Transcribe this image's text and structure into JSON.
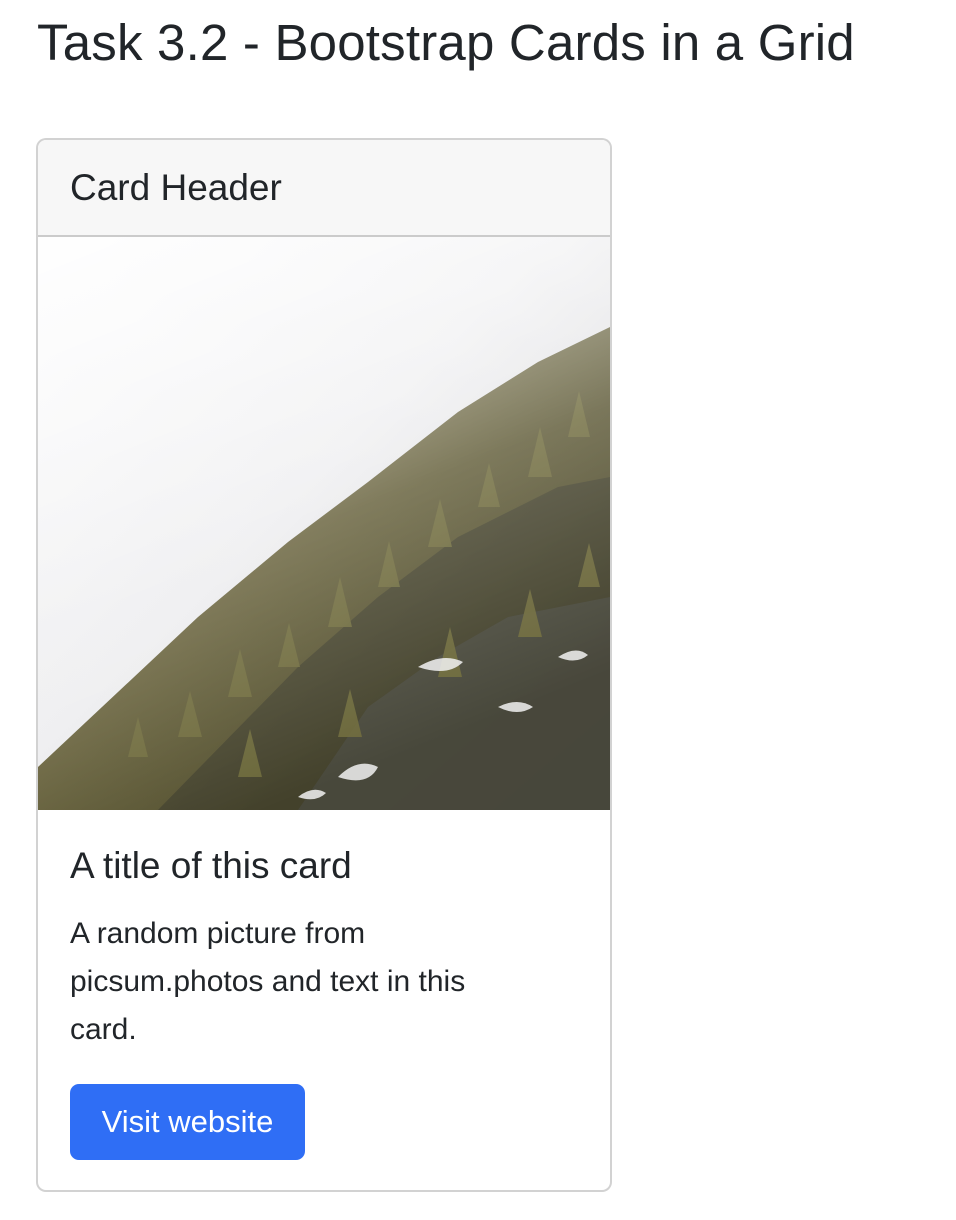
{
  "page": {
    "title": "Task 3.2 - Bootstrap Cards in a Grid"
  },
  "card": {
    "header": "Card Header",
    "image": {
      "description": "mountain-forest-fog"
    },
    "title": "A title of this card",
    "text": "A random picture from picsum.photos and text in this card.",
    "button_label": "Visit website",
    "button_color": "#2f6ef5"
  }
}
